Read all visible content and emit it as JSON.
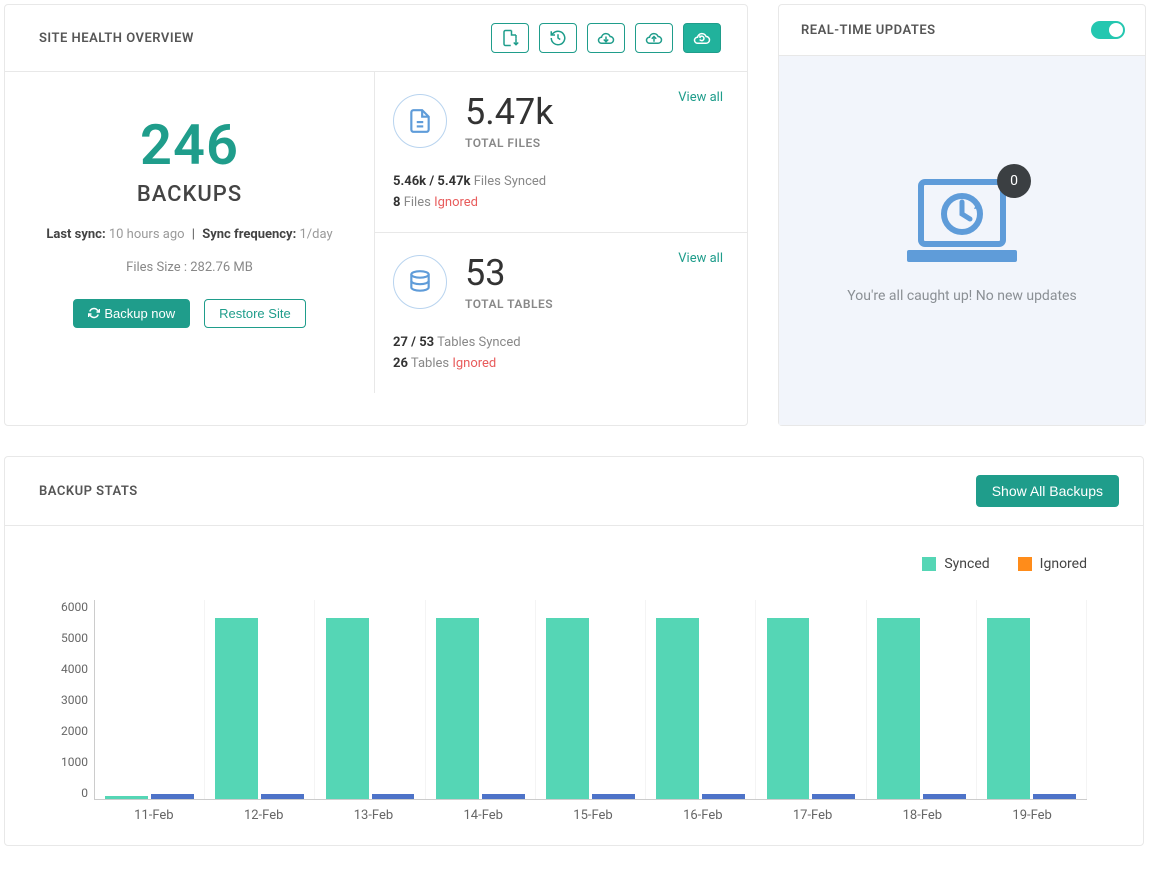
{
  "colors": {
    "accent": "#1f9d8b",
    "synced": "#55d6b5",
    "ignored_bar": "#4e73c8",
    "ignored_text": "#e85c5c"
  },
  "health": {
    "title": "SITE HEALTH OVERVIEW",
    "backups": {
      "count": "246",
      "label": "BACKUPS",
      "last_sync_label": "Last sync:",
      "last_sync_value": "10 hours ago",
      "divider": "|",
      "freq_label": "Sync frequency:",
      "freq_value": "1/day",
      "files_size_label": "Files Size :",
      "files_size_value": "282.76 MB",
      "backup_btn": "Backup now",
      "restore_btn": "Restore Site"
    },
    "files": {
      "view_all": "View all",
      "count": "5.47k",
      "label": "TOTAL FILES",
      "synced_counts": "5.46k / 5.47k",
      "synced_suffix": "Files Synced",
      "ignored_count": "8",
      "ignored_mid": "Files",
      "ignored_label": "Ignored"
    },
    "tables": {
      "view_all": "View all",
      "count": "53",
      "label": "TOTAL TABLES",
      "synced_counts": "27 / 53",
      "synced_suffix": "Tables Synced",
      "ignored_count": "26",
      "ignored_mid": "Tables",
      "ignored_label": "Ignored"
    }
  },
  "updates": {
    "title": "REAL-TIME UPDATES",
    "badge": "0",
    "message": "You're all caught up! No new updates"
  },
  "stats": {
    "title": "BACKUP STATS",
    "show_all": "Show All Backups",
    "legend_synced": "Synced",
    "legend_ignored": "Ignored"
  },
  "chart_data": {
    "type": "bar",
    "categories": [
      "11-Feb",
      "12-Feb",
      "13-Feb",
      "14-Feb",
      "15-Feb",
      "16-Feb",
      "17-Feb",
      "18-Feb",
      "19-Feb"
    ],
    "series": [
      {
        "name": "Synced",
        "values": [
          100,
          5470,
          5470,
          5470,
          5470,
          5470,
          5470,
          5470,
          5470
        ]
      },
      {
        "name": "Ignored",
        "values": [
          150,
          150,
          150,
          150,
          150,
          150,
          150,
          150,
          150
        ]
      }
    ],
    "ylim": [
      0,
      6000
    ],
    "yticks": [
      0,
      1000,
      2000,
      3000,
      4000,
      5000,
      6000
    ],
    "xlabel": "",
    "ylabel": ""
  }
}
